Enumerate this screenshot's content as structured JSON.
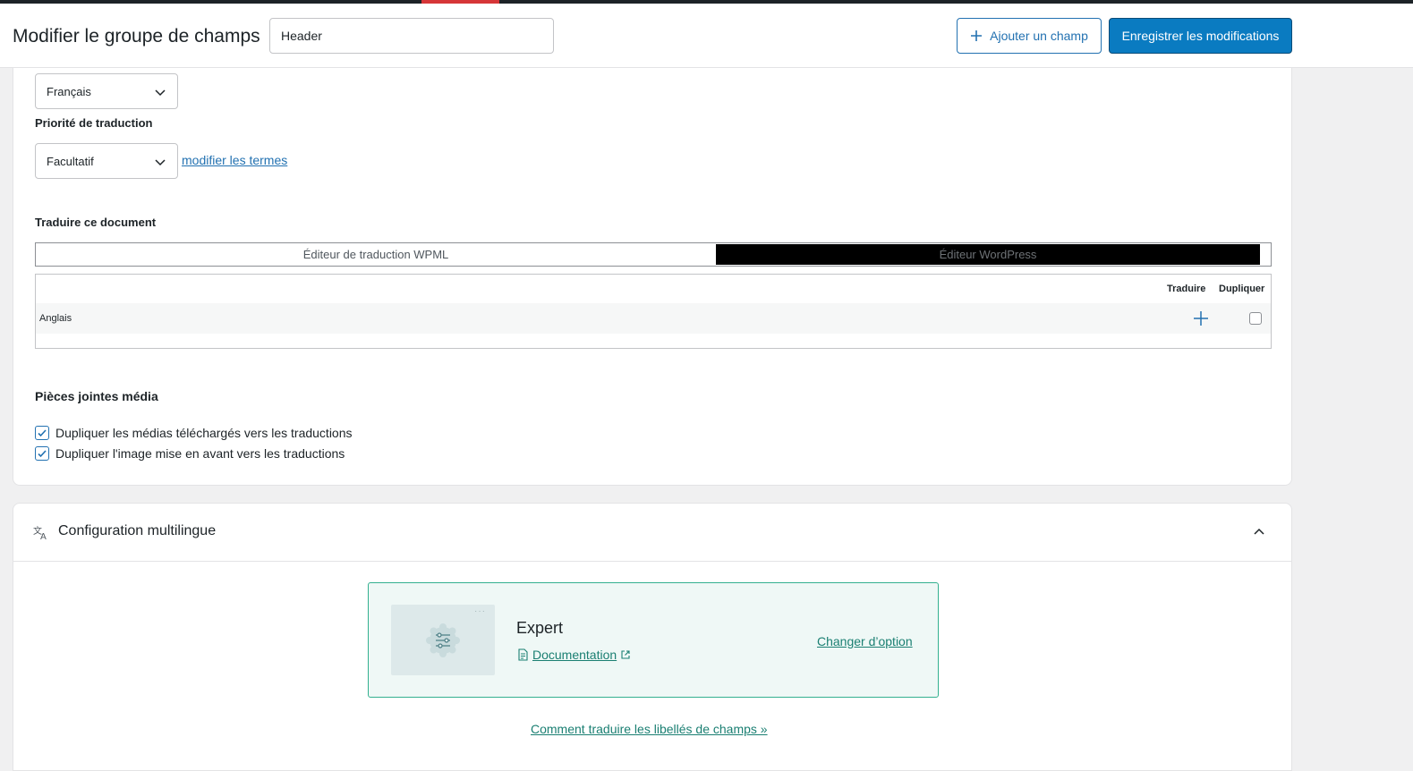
{
  "header": {
    "title": "Modifier le groupe de champs",
    "title_input_value": "Header",
    "add_field_label": "Ajouter un champ",
    "save_label": "Enregistrer les modifications"
  },
  "translation_settings": {
    "language_select": "Français",
    "priority_label": "Priorité de traduction",
    "priority_select": "Facultatif",
    "edit_terms_link": "modifier les termes",
    "translate_document_label": "Traduire ce document",
    "editor_tabs": [
      "Éditeur de traduction WPML",
      "Éditeur WordPress"
    ],
    "table": {
      "col_translate": "Traduire",
      "col_duplicate": "Dupliquer",
      "rows": [
        {
          "language": "Anglais",
          "duplicate_checked": false
        }
      ]
    },
    "media_label": "Pièces jointes média",
    "media_options": [
      {
        "label": "Dupliquer les médias téléchargés vers les traductions",
        "checked": true
      },
      {
        "label": "Dupliquer l'image mise en avant vers les traductions",
        "checked": true
      }
    ]
  },
  "multilingual": {
    "title": "Configuration multilingue",
    "mode_title": "Expert",
    "documentation_link": "Documentation",
    "change_option_link": "Changer d’option",
    "help_link": "Comment traduire les libellés de champs »"
  },
  "colors": {
    "primary_button": "#0a7bc1",
    "link_blue": "#2271b1",
    "teal": "#1a7f72",
    "accent_top": "#d63638"
  }
}
